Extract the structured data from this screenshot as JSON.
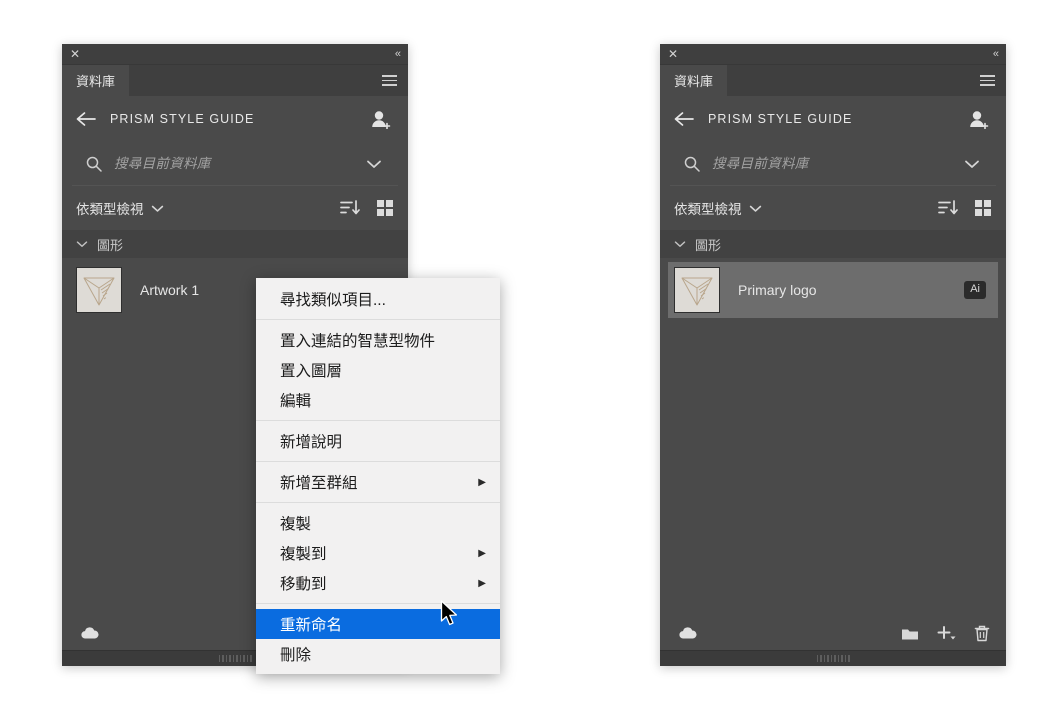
{
  "window": {
    "close_label": "✕",
    "collapse_label": "«",
    "menu_icon": "hamburger-icon"
  },
  "tab": {
    "label": "資料庫"
  },
  "header": {
    "back_icon": "back-arrow-icon",
    "title": "PRISM STYLE GUIDE",
    "invite_icon": "invite-user-icon"
  },
  "search": {
    "icon": "search-icon",
    "placeholder": "搜尋目前資料庫",
    "value": "",
    "chevron_icon": "chevron-down-icon"
  },
  "filter": {
    "label": "依類型檢視",
    "chevron_icon": "chevron-down-icon",
    "sort_icon": "sort-descending-icon",
    "grid_icon": "grid-view-icon"
  },
  "group": {
    "chevron_icon": "chevron-down-icon",
    "label": "圖形"
  },
  "assets": {
    "left": {
      "name": "Artwork 1",
      "badge": "",
      "thumb": "logo-chevron-thumbnail",
      "selected": false
    },
    "right": {
      "name": "Primary logo",
      "badge": "Ai",
      "thumb": "logo-chevron-thumbnail",
      "selected": true
    }
  },
  "footer": {
    "cloud_icon": "cloud-sync-icon",
    "folder_icon": "new-folder-icon",
    "add_icon": "add-content-icon",
    "delete_icon": "delete-trash-icon"
  },
  "context_menu": {
    "items": [
      {
        "label": "尋找類似項目...",
        "submenu": false,
        "highlight": false,
        "sep_after": true
      },
      {
        "label": "置入連結的智慧型物件",
        "submenu": false,
        "highlight": false,
        "sep_after": false
      },
      {
        "label": "置入圖層",
        "submenu": false,
        "highlight": false,
        "sep_after": false
      },
      {
        "label": "編輯",
        "submenu": false,
        "highlight": false,
        "sep_after": true
      },
      {
        "label": "新增說明",
        "submenu": false,
        "highlight": false,
        "sep_after": true
      },
      {
        "label": "新增至群組",
        "submenu": true,
        "highlight": false,
        "sep_after": true
      },
      {
        "label": "複製",
        "submenu": false,
        "highlight": false,
        "sep_after": false
      },
      {
        "label": "複製到",
        "submenu": true,
        "highlight": false,
        "sep_after": false
      },
      {
        "label": "移動到",
        "submenu": true,
        "highlight": false,
        "sep_after": true
      },
      {
        "label": "重新命名",
        "submenu": false,
        "highlight": true,
        "sep_after": false
      },
      {
        "label": "刪除",
        "submenu": false,
        "highlight": false,
        "sep_after": false
      }
    ],
    "submenu_arrow": "▶"
  },
  "colors": {
    "panel_bg": "#4a4a4a",
    "titlebar_bg": "#3f3f3f",
    "selected_row": "#6d6d6d",
    "menu_bg": "#f2f1f1",
    "menu_highlight": "#0a6ce0",
    "logo_tan": "#b9a68c"
  },
  "cursor": {
    "icon": "mouse-pointer-icon"
  }
}
